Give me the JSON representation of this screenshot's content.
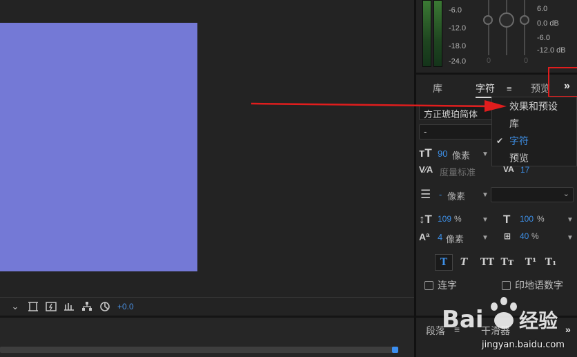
{
  "audio": {
    "left_db": [
      "-6.0",
      "-12.0",
      "-18.0",
      "-24.0"
    ],
    "right_db": [
      "6.0",
      "0.0 dB",
      "-6.0",
      "-12.0 dB"
    ],
    "zeros": [
      "0",
      "0"
    ]
  },
  "viewer": {
    "exposure": "+0.0"
  },
  "panel": {
    "tabs": [
      "库",
      "字符",
      "预览"
    ],
    "active_tab": "字符",
    "hamburger": "≡",
    "overflow": "»"
  },
  "character": {
    "font_family": "方正琥珀简体",
    "font_style": "-",
    "font_size": "90",
    "font_size_unit": "像素",
    "kerning": "度量标准",
    "tracking": "17",
    "leading_value": "-",
    "leading_unit": "像素",
    "vscale": "109",
    "vscale_unit": "%",
    "hscale": "100",
    "hscale_unit": "%",
    "baseline": "4",
    "baseline_unit": "像素",
    "tsume": "40",
    "tsume_unit": "%",
    "style_buttons": [
      "T",
      "T",
      "TT",
      "Tт",
      "T¹",
      "T₁"
    ],
    "ligature_label": "连字",
    "hindi_digits_label": "印地语数字"
  },
  "menu": {
    "items": [
      "效果和预设",
      "库",
      "字符",
      "预览"
    ],
    "checked": "字符"
  },
  "bottom_panel": {
    "tabs": [
      "段落",
      "≡",
      "干滑器"
    ]
  },
  "watermark": {
    "url": "jingyan.baidu.com"
  },
  "colors": {
    "canvas": "#7479d6",
    "accent_blue": "#3d8fe6",
    "annotation_red": "#e11d1d"
  }
}
